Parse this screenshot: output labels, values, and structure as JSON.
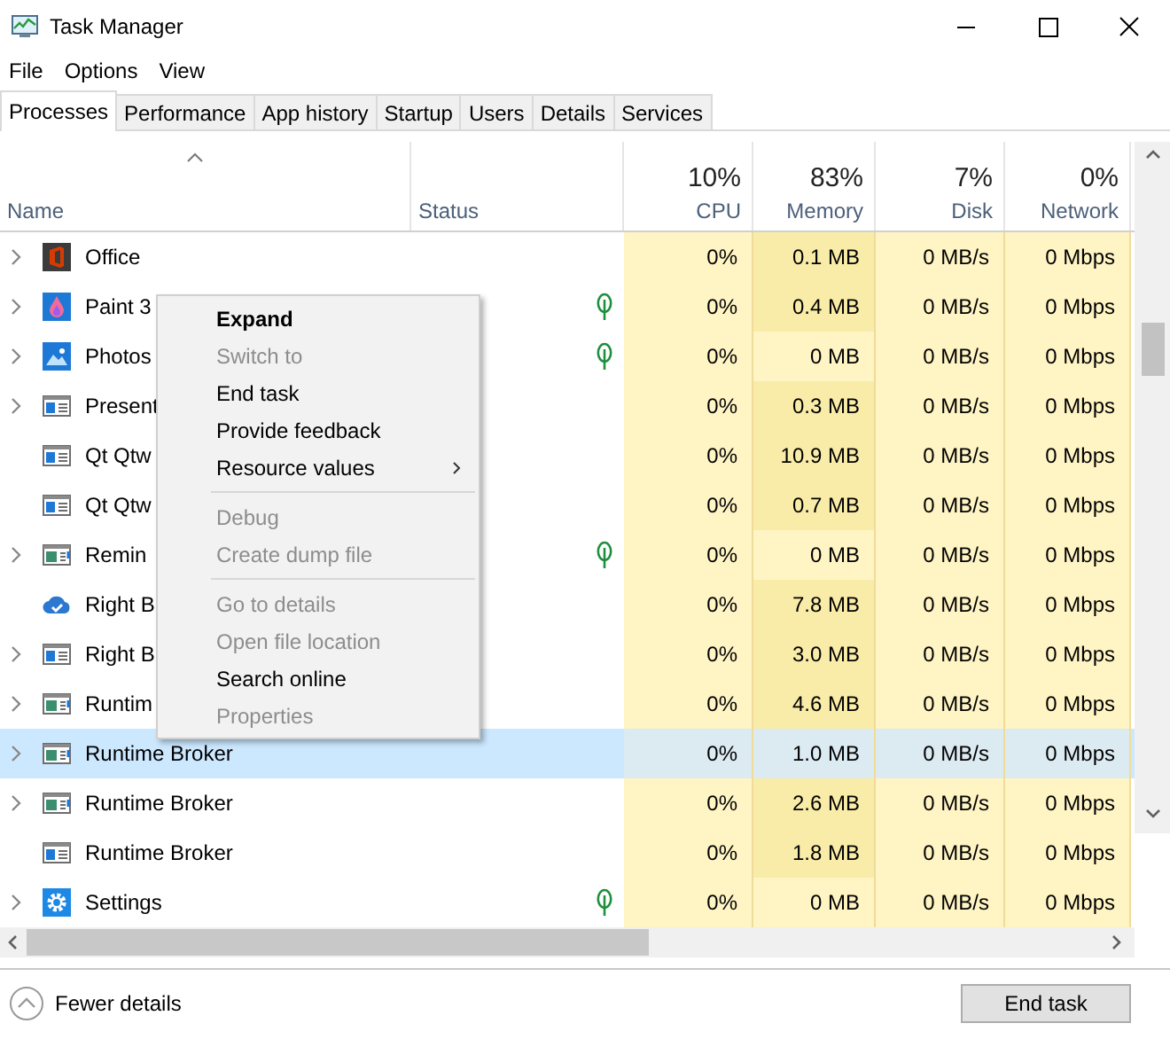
{
  "window": {
    "title": "Task Manager"
  },
  "menu_bar": [
    "File",
    "Options",
    "View"
  ],
  "tabs": [
    {
      "label": "Processes",
      "selected": true
    },
    {
      "label": "Performance",
      "selected": false
    },
    {
      "label": "App history",
      "selected": false
    },
    {
      "label": "Startup",
      "selected": false
    },
    {
      "label": "Users",
      "selected": false
    },
    {
      "label": "Details",
      "selected": false
    },
    {
      "label": "Services",
      "selected": false
    }
  ],
  "table": {
    "columns": [
      {
        "label": "Name",
        "kind": "name"
      },
      {
        "label": "Status",
        "kind": "status"
      },
      {
        "label": "CPU",
        "total": "10%",
        "kind": "metric"
      },
      {
        "label": "Memory",
        "total": "83%",
        "kind": "metric"
      },
      {
        "label": "Disk",
        "total": "7%",
        "kind": "metric"
      },
      {
        "label": "Network",
        "total": "0%",
        "kind": "metric"
      }
    ],
    "rows": [
      {
        "name": "Office",
        "kind": "office",
        "expandable": true,
        "suspended": false,
        "selected": false,
        "memory_active": true,
        "cpu": "0%",
        "memory": "0.1 MB",
        "disk": "0 MB/s",
        "network": "0 Mbps"
      },
      {
        "name": "Paint 3",
        "kind": "paint",
        "expandable": true,
        "suspended": true,
        "selected": false,
        "memory_active": true,
        "cpu": "0%",
        "memory": "0.4 MB",
        "disk": "0 MB/s",
        "network": "0 Mbps"
      },
      {
        "name": "Photos",
        "kind": "photos",
        "expandable": true,
        "suspended": true,
        "selected": false,
        "memory_active": false,
        "cpu": "0%",
        "memory": "0 MB",
        "disk": "0 MB/s",
        "network": "0 Mbps"
      },
      {
        "name": "Present",
        "kind": "window",
        "expandable": true,
        "suspended": false,
        "selected": false,
        "memory_active": true,
        "cpu": "0%",
        "memory": "0.3 MB",
        "disk": "0 MB/s",
        "network": "0 Mbps"
      },
      {
        "name": "Qt Qtw",
        "kind": "window",
        "expandable": false,
        "suspended": false,
        "selected": false,
        "memory_active": true,
        "cpu": "0%",
        "memory": "10.9 MB",
        "disk": "0 MB/s",
        "network": "0 Mbps"
      },
      {
        "name": "Qt Qtw",
        "kind": "window",
        "expandable": false,
        "suspended": false,
        "selected": false,
        "memory_active": true,
        "cpu": "0%",
        "memory": "0.7 MB",
        "disk": "0 MB/s",
        "network": "0 Mbps"
      },
      {
        "name": "Remin",
        "kind": "app",
        "expandable": true,
        "suspended": true,
        "selected": false,
        "memory_active": false,
        "cpu": "0%",
        "memory": "0 MB",
        "disk": "0 MB/s",
        "network": "0 Mbps"
      },
      {
        "name": "Right B",
        "kind": "cloud",
        "expandable": false,
        "suspended": false,
        "selected": false,
        "memory_active": true,
        "cpu": "0%",
        "memory": "7.8 MB",
        "disk": "0 MB/s",
        "network": "0 Mbps"
      },
      {
        "name": "Right B",
        "kind": "window",
        "expandable": true,
        "suspended": false,
        "selected": false,
        "memory_active": true,
        "cpu": "0%",
        "memory": "3.0 MB",
        "disk": "0 MB/s",
        "network": "0 Mbps"
      },
      {
        "name": "Runtim",
        "kind": "app",
        "expandable": true,
        "suspended": false,
        "selected": false,
        "memory_active": true,
        "cpu": "0%",
        "memory": "4.6 MB",
        "disk": "0 MB/s",
        "network": "0 Mbps"
      },
      {
        "name": "Runtime Broker",
        "kind": "app",
        "expandable": true,
        "suspended": false,
        "selected": true,
        "memory_active": true,
        "cpu": "0%",
        "memory": "1.0 MB",
        "disk": "0 MB/s",
        "network": "0 Mbps"
      },
      {
        "name": "Runtime Broker",
        "kind": "app",
        "expandable": true,
        "suspended": false,
        "selected": false,
        "memory_active": true,
        "cpu": "0%",
        "memory": "2.6 MB",
        "disk": "0 MB/s",
        "network": "0 Mbps"
      },
      {
        "name": "Runtime Broker",
        "kind": "window",
        "expandable": false,
        "suspended": false,
        "selected": false,
        "memory_active": true,
        "cpu": "0%",
        "memory": "1.8 MB",
        "disk": "0 MB/s",
        "network": "0 Mbps"
      },
      {
        "name": "Settings",
        "kind": "gear",
        "expandable": true,
        "suspended": true,
        "selected": false,
        "memory_active": false,
        "cpu": "0%",
        "memory": "0 MB",
        "disk": "0 MB/s",
        "network": "0 Mbps"
      }
    ]
  },
  "context_menu": [
    {
      "kind": "item",
      "label": "Expand",
      "default": true,
      "disabled": false,
      "submenu": false
    },
    {
      "kind": "item",
      "label": "Switch to",
      "default": false,
      "disabled": true,
      "submenu": false
    },
    {
      "kind": "item",
      "label": "End task",
      "default": false,
      "disabled": false,
      "submenu": false
    },
    {
      "kind": "item",
      "label": "Provide feedback",
      "default": false,
      "disabled": false,
      "submenu": false
    },
    {
      "kind": "item",
      "label": "Resource values",
      "default": false,
      "disabled": false,
      "submenu": true
    },
    {
      "kind": "separator"
    },
    {
      "kind": "item",
      "label": "Debug",
      "default": false,
      "disabled": true,
      "submenu": false
    },
    {
      "kind": "item",
      "label": "Create dump file",
      "default": false,
      "disabled": true,
      "submenu": false
    },
    {
      "kind": "separator"
    },
    {
      "kind": "item",
      "label": "Go to details",
      "default": false,
      "disabled": true,
      "submenu": false
    },
    {
      "kind": "item",
      "label": "Open file location",
      "default": false,
      "disabled": true,
      "submenu": false
    },
    {
      "kind": "item",
      "label": "Search online",
      "default": false,
      "disabled": false,
      "submenu": false
    },
    {
      "kind": "item",
      "label": "Properties",
      "default": false,
      "disabled": true,
      "submenu": false
    }
  ],
  "footer": {
    "toggle": "Fewer details",
    "button": "End task"
  }
}
